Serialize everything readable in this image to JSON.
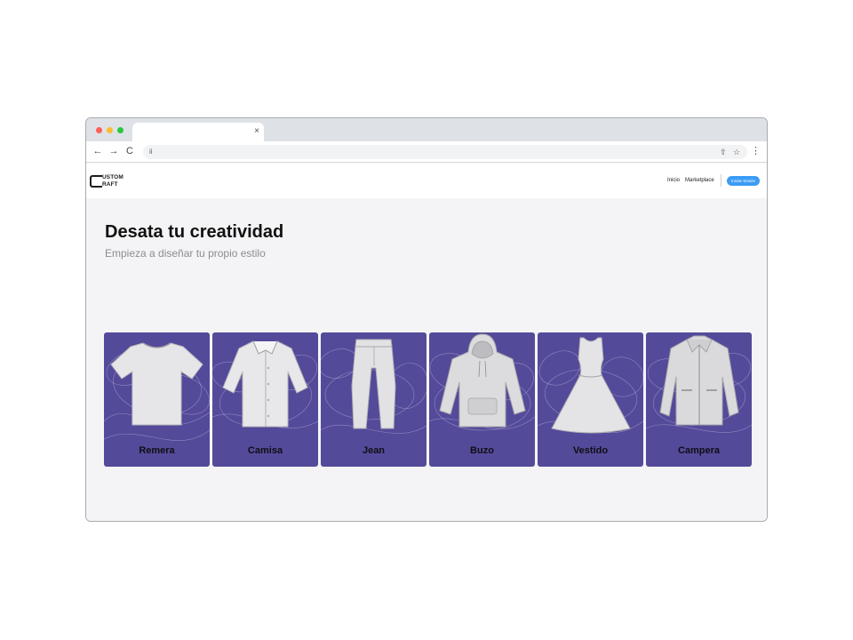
{
  "browser": {
    "tab_close": "×",
    "back": "←",
    "forward": "→",
    "reload": "C",
    "lock": "ii",
    "share": "⇧",
    "bookmark": "☆",
    "menu": "⋮"
  },
  "site": {
    "logo_line1": "USTOM",
    "logo_line2": "RAFT",
    "nav": {
      "inicio": "Inicio",
      "marketplace": "Marketplace",
      "login": "Iniciar Sesión"
    },
    "hero": {
      "title": "Desata tu creatividad",
      "subtitle": "Empieza a diseñar tu propio estilo"
    },
    "cards": [
      {
        "label": "Remera",
        "icon": "tshirt-icon"
      },
      {
        "label": "Camisa",
        "icon": "shirt-icon"
      },
      {
        "label": "Jean",
        "icon": "jeans-icon"
      },
      {
        "label": "Buzo",
        "icon": "hoodie-icon"
      },
      {
        "label": "Vestido",
        "icon": "dress-icon"
      },
      {
        "label": "Campera",
        "icon": "jacket-icon"
      }
    ]
  },
  "colors": {
    "card_bg": "#544a9a",
    "login_button": "#3b9cf5",
    "page_bg": "#f4f4f6"
  }
}
